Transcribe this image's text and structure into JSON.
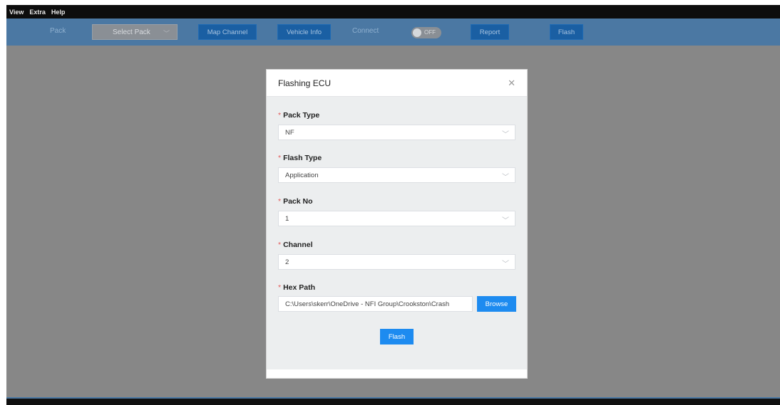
{
  "menu": {
    "items": [
      "View",
      "Extra",
      "Help"
    ]
  },
  "toolbar": {
    "pack_label": "Pack",
    "select_pack": "Select Pack",
    "map_channel": "Map Channel",
    "vehicle_info": "Vehicle Info",
    "connect_label": "Connect",
    "toggle_text": "OFF",
    "report": "Report",
    "flash": "Flash"
  },
  "modal": {
    "title": "Flashing ECU",
    "fields": [
      {
        "label": "Pack Type",
        "value": "NF"
      },
      {
        "label": "Flash Type",
        "value": "Application"
      },
      {
        "label": "Pack No",
        "value": "1"
      },
      {
        "label": "Channel",
        "value": "2"
      }
    ],
    "hex_path": {
      "label": "Hex Path",
      "value": "C:\\Users\\skerr\\OneDrive - NFI Group\\Crookston\\Crash",
      "browse": "Browse"
    },
    "flash_button": "Flash"
  },
  "colors": {
    "toolbar_bg": "#4b78a3",
    "button_blue": "#1a5fa3",
    "primary": "#1d8bf0",
    "required": "#e35b5b",
    "backdrop": "#878787"
  }
}
